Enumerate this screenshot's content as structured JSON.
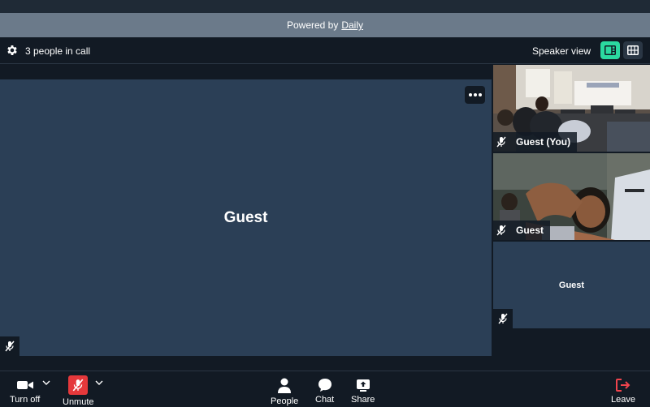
{
  "banner": {
    "prefix": "Powered by",
    "link": "Daily"
  },
  "header": {
    "people_count": "3 people in call",
    "speaker_view_label": "Speaker view"
  },
  "main_tile": {
    "name": "Guest"
  },
  "side_tiles": [
    {
      "name": "Guest (You)"
    },
    {
      "name": "Guest"
    },
    {
      "name": "Guest"
    }
  ],
  "toolbar": {
    "camera_label": "Turn off",
    "mic_label": "Unmute",
    "people_label": "People",
    "chat_label": "Chat",
    "share_label": "Share",
    "leave_label": "Leave"
  },
  "colors": {
    "accent": "#2bd9a0",
    "tile": "#2b3f56",
    "mic_off": "#e5383b",
    "leave": "#f0444d"
  }
}
